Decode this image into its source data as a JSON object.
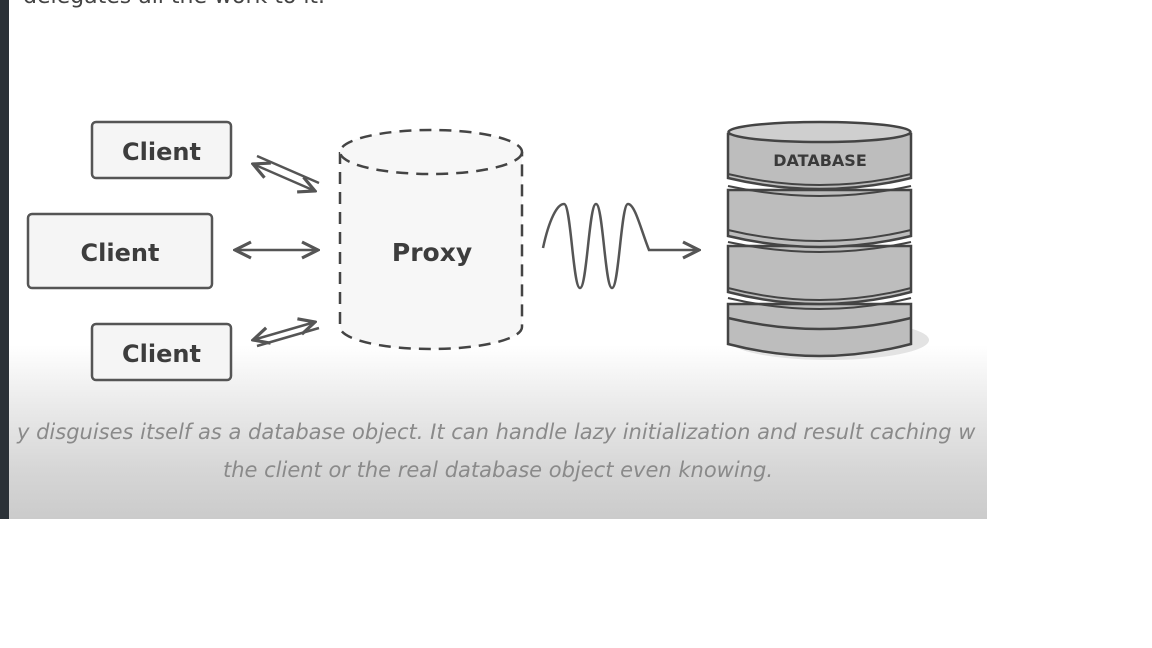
{
  "heading_fragment": "delegates all the work to it.",
  "diagram": {
    "clients": [
      "Client",
      "Client",
      "Client"
    ],
    "proxy_label": "Proxy",
    "database_label": "DATABASE"
  },
  "caption": {
    "line1": "y disguises itself as a database object. It can handle lazy initialization and result caching w",
    "line2": "the client or the real database object even knowing."
  },
  "colors": {
    "stroke": "#555555",
    "box_fill": "#f5f5f5",
    "db_fill": "#bdbdbd",
    "caption_text": "#8a8a8a"
  }
}
